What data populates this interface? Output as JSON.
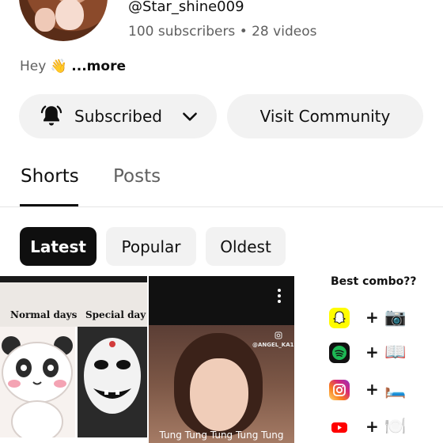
{
  "channel": {
    "handle": "@Star_shine009",
    "stats": "100 subscribers • 28 videos",
    "bio_text": "Hey",
    "bio_emoji": "👋",
    "bio_more": "...more"
  },
  "actions": {
    "subscribed_label": "Subscribed",
    "visit_community_label": "Visit Community"
  },
  "tabs": [
    {
      "label": "Shorts",
      "active": true
    },
    {
      "label": "Posts",
      "active": false
    }
  ],
  "filters": [
    {
      "label": "Latest",
      "selected": true
    },
    {
      "label": "Popular",
      "selected": false
    },
    {
      "label": "Oldest",
      "selected": false
    }
  ],
  "shorts": [
    {
      "caption_left": "Normal days",
      "caption_right": "Special day"
    },
    {
      "caption": "Tung Tung Tung Tung Tung",
      "watermark": "@ANGEL_KA11046"
    },
    {
      "title": "Best combo??",
      "combos": [
        {
          "app": "snapchat-icon",
          "color": "#FFFC00",
          "emoji": "📷"
        },
        {
          "app": "spotify-icon",
          "color": "#1DB954",
          "emoji": "📖"
        },
        {
          "app": "instagram-icon",
          "color": "#E1306C",
          "emoji": "🛏️"
        },
        {
          "app": "youtube-icon",
          "color": "#FF0000",
          "emoji": "🍽️"
        }
      ],
      "plus": "+"
    }
  ]
}
